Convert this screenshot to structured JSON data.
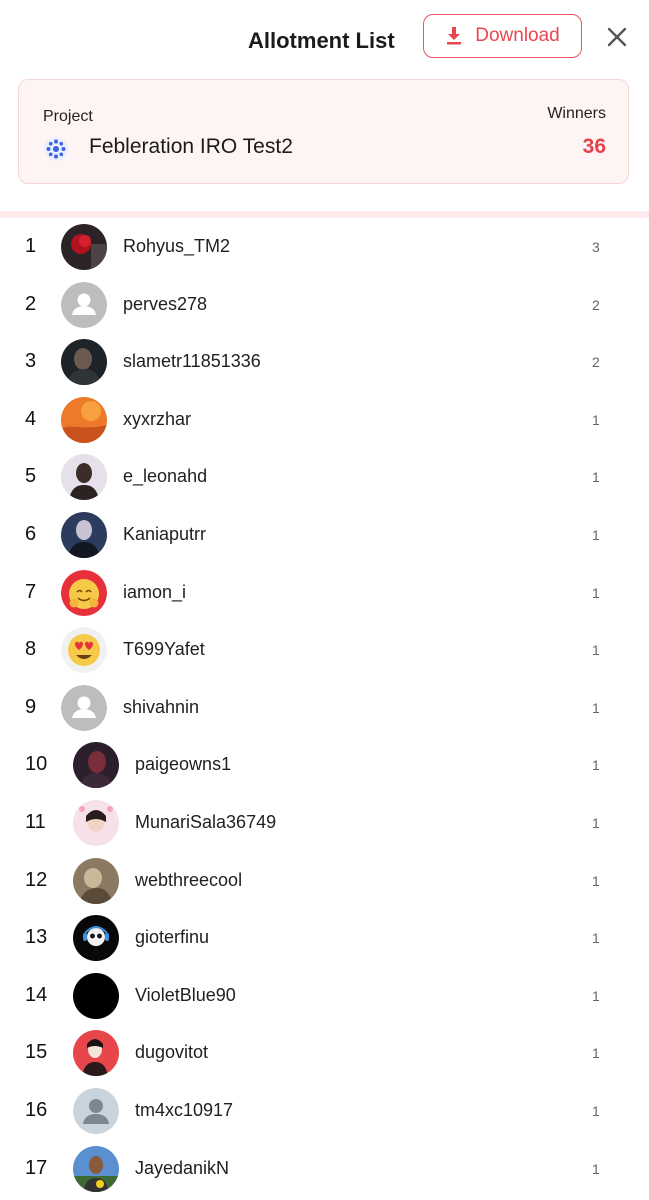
{
  "header": {
    "title": "Allotment List",
    "download_label": "Download"
  },
  "project": {
    "label": "Project",
    "name": "Febleration IRO Test2",
    "winners_label": "Winners",
    "winners_count": "36"
  },
  "colors": {
    "accent": "#e8474f",
    "card_bg": "#fff4f4",
    "divider": "#fde9e9"
  },
  "winners": [
    {
      "rank": "1",
      "username": "Rohyus_TM2",
      "count": "3",
      "avatar": "photo-red-rose"
    },
    {
      "rank": "2",
      "username": "perves278",
      "count": "2",
      "avatar": "default-avatar"
    },
    {
      "rank": "3",
      "username": "slametr11851336",
      "count": "2",
      "avatar": "photo-person-dark"
    },
    {
      "rank": "4",
      "username": "xyxrzhar",
      "count": "1",
      "avatar": "photo-orange-sky"
    },
    {
      "rank": "5",
      "username": "e_leonahd",
      "count": "1",
      "avatar": "photo-person-light"
    },
    {
      "rank": "6",
      "username": "Kaniaputrr",
      "count": "1",
      "avatar": "photo-person-blue"
    },
    {
      "rank": "7",
      "username": "iamon_i",
      "count": "1",
      "avatar": "emoji-hugging-face"
    },
    {
      "rank": "8",
      "username": "T699Yafet",
      "count": "1",
      "avatar": "emoji-heart-eyes"
    },
    {
      "rank": "9",
      "username": "shivahnin",
      "count": "1",
      "avatar": "default-avatar"
    },
    {
      "rank": "10",
      "username": "paigeowns1",
      "count": "1",
      "avatar": "photo-person-dark-red"
    },
    {
      "rank": "11",
      "username": "MunariSala36749",
      "count": "1",
      "avatar": "photo-person-pink"
    },
    {
      "rank": "12",
      "username": "webthreecool",
      "count": "1",
      "avatar": "photo-sepia"
    },
    {
      "rank": "13",
      "username": "gioterfinu",
      "count": "1",
      "avatar": "photo-panda-headphones"
    },
    {
      "rank": "14",
      "username": "VioletBlue90",
      "count": "1",
      "avatar": "solid-black"
    },
    {
      "rank": "15",
      "username": "dugovitot",
      "count": "1",
      "avatar": "photo-red-figure"
    },
    {
      "rank": "16",
      "username": "tm4xc10917",
      "count": "1",
      "avatar": "default-avatar-blue"
    },
    {
      "rank": "17",
      "username": "JayedanikN",
      "count": "1",
      "avatar": "photo-person-outdoor"
    }
  ]
}
